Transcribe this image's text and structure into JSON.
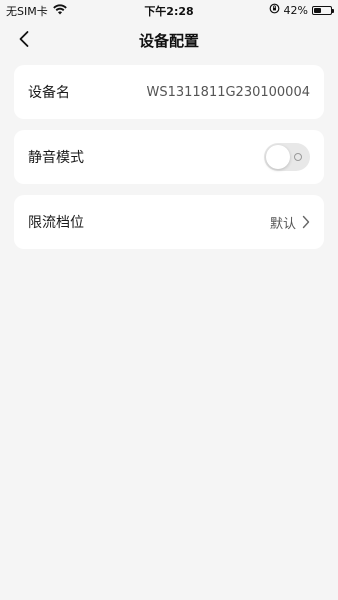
{
  "status_bar": {
    "carrier": "无SIM卡",
    "time": "下午2:28",
    "battery_percent": "42%",
    "battery_level": 0.42,
    "icons": [
      "wifi-icon",
      "orientation-lock-icon",
      "battery-icon"
    ]
  },
  "nav": {
    "title": "设备配置",
    "back_icon": "chevron-left-icon"
  },
  "settings": {
    "device_name": {
      "label": "设备名",
      "value": "WS1311811G230100004"
    },
    "silent_mode": {
      "label": "静音模式",
      "enabled": false
    },
    "current_limit": {
      "label": "限流档位",
      "value": "默认",
      "icon": "chevron-right-icon"
    }
  },
  "colors": {
    "background": "#f5f5f5",
    "card": "#ffffff",
    "toggle_off": "#e8e8e8"
  }
}
